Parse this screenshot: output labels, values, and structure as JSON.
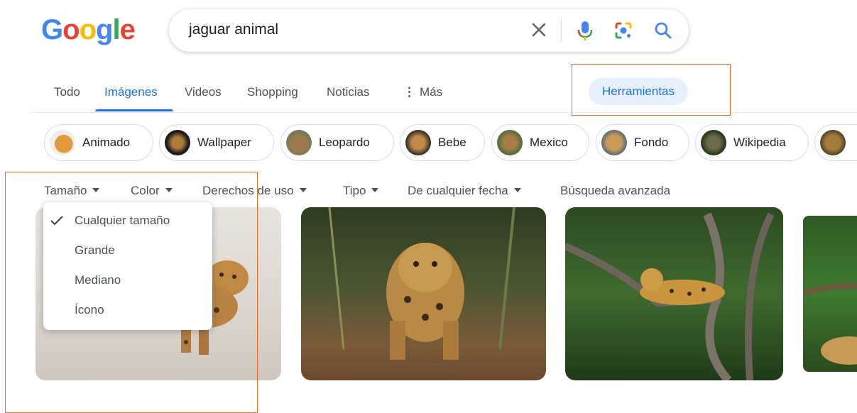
{
  "logo": {
    "text": "Google"
  },
  "search": {
    "query": "jaguar animal"
  },
  "tabs": [
    {
      "label": "Todo"
    },
    {
      "label": "Imágenes"
    },
    {
      "label": "Videos"
    },
    {
      "label": "Shopping"
    },
    {
      "label": "Noticias"
    },
    {
      "label": "Más"
    }
  ],
  "tools_button": {
    "label": "Herramientas"
  },
  "chips": [
    {
      "label": "Animado"
    },
    {
      "label": "Wallpaper"
    },
    {
      "label": "Leopardo"
    },
    {
      "label": "Bebe"
    },
    {
      "label": "Mexico"
    },
    {
      "label": "Fondo"
    },
    {
      "label": "Wikipedia"
    }
  ],
  "filters": {
    "size": "Tamaño",
    "color": "Color",
    "rights": "Derechos de uso",
    "type": "Tipo",
    "date": "De cualquier fecha",
    "advanced": "Búsqueda avanzada"
  },
  "size_menu": {
    "items": [
      "Cualquier tamaño",
      "Grande",
      "Mediano",
      "Ícono"
    ],
    "selected": "Cualquier tamaño"
  },
  "colors": {
    "accent": "#1a73e8",
    "annotation": "#e46c2b",
    "tab_active": "#1a73e8"
  }
}
